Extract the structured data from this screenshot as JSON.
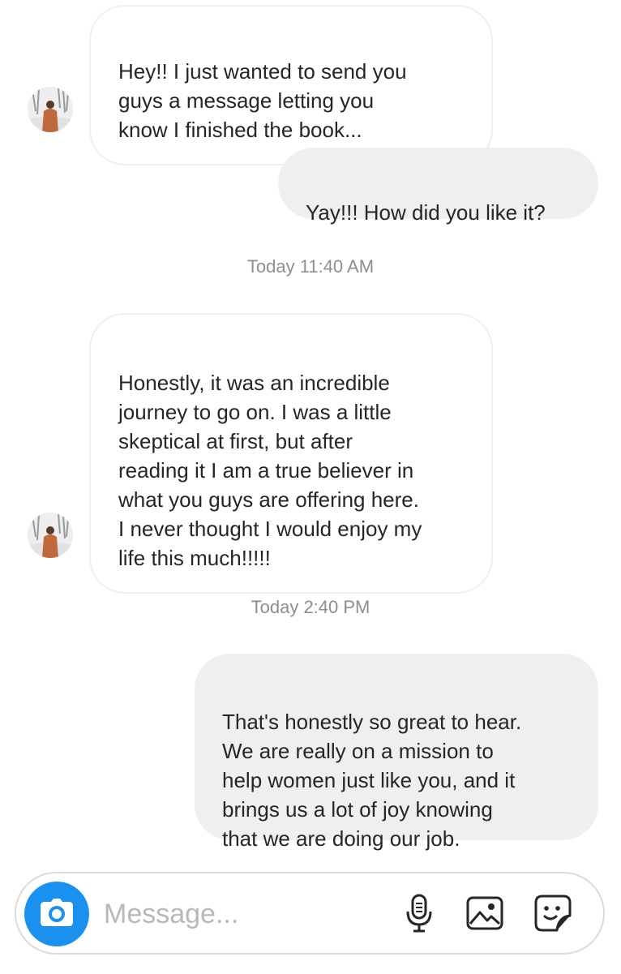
{
  "thread": {
    "messages": [
      {
        "direction": "incoming",
        "text": "Hey!! I just wanted to send you\nguys a message letting you\nknow I finished the book..."
      },
      {
        "direction": "outgoing",
        "text": "Yay!!! How did you like it?"
      },
      {
        "direction": "incoming",
        "text": "Honestly, it was an incredible\njourney to go on. I was a little\nskeptical at first, but after\nreading it I am a true believer in\nwhat you guys are offering here.\nI never thought I would enjoy my\nlife this much!!!!!"
      },
      {
        "direction": "outgoing",
        "text": "That's honestly so great to hear.\nWe are really on a mission to\nhelp women just like you, and it\nbrings us a lot of joy knowing\nthat we are doing our job."
      }
    ],
    "timestamps": [
      "Today 11:40 AM",
      "Today 2:40 PM"
    ]
  },
  "composer": {
    "placeholder": "Message...",
    "value": "",
    "icons": [
      "camera-icon",
      "microphone-icon",
      "image-icon",
      "sticker-icon"
    ]
  },
  "colors": {
    "accent": "#1a91ee",
    "outgoing_bubble": "#efefef",
    "incoming_border": "#efefef",
    "timestamp_text": "#8e8e8e",
    "placeholder_text": "#b8b8b8"
  }
}
